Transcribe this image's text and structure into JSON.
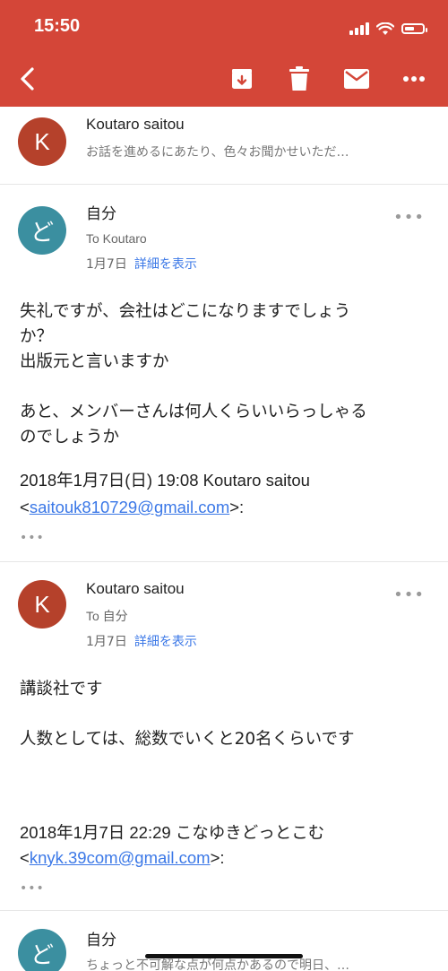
{
  "status_bar": {
    "time": "15:50"
  },
  "toolbar": {
    "back_icon": "chevron-left-icon",
    "actions": [
      "archive-icon",
      "trash-icon",
      "mail-icon",
      "more-icon"
    ],
    "color": "#d44638"
  },
  "messages": [
    {
      "avatar_letter": "K",
      "avatar_color": "#b5412b",
      "sender": "Koutaro saitou",
      "snippet": "お話を進めるにあたり、色々お聞かせいただ…",
      "collapsed": true
    },
    {
      "avatar_letter": "ど",
      "avatar_color": "#3b8fa0",
      "sender": "自分",
      "to": "To Koutaro",
      "date": "1月7日",
      "details_link": "詳細を表示",
      "more": "•••",
      "body": "失礼ですが、会社はどこになりますでしょう\nか？\n出版元と言いますか\n\nあと、メンバーさんは何人くらいいらっしゃる\nのでしょうか",
      "quote_header": "2018年1月7日(日) 19:08 Koutaro saitou",
      "quote_open": "<",
      "quote_email": "saitouk810729@gmail.com",
      "quote_close": ">:",
      "ellipsis": "•••"
    },
    {
      "avatar_letter": "K",
      "avatar_color": "#b5412b",
      "sender": "Koutaro saitou",
      "to": "To 自分",
      "date": "1月7日",
      "details_link": "詳細を表示",
      "more": "•••",
      "body": "講談社です\n\n人数としては、総数でいくと20名くらいです",
      "quote_header": "2018年1月7日 22:29 こなゆきどっとこむ",
      "quote_open": "<",
      "quote_email": "knyk.39com@gmail.com",
      "quote_close": ">:",
      "ellipsis": "•••"
    },
    {
      "avatar_letter": "ど",
      "avatar_color": "#3b8fa0",
      "sender": "自分",
      "snippet": "ちょっと不可解な点が何点かあるので明日、…",
      "collapsed": true
    }
  ]
}
